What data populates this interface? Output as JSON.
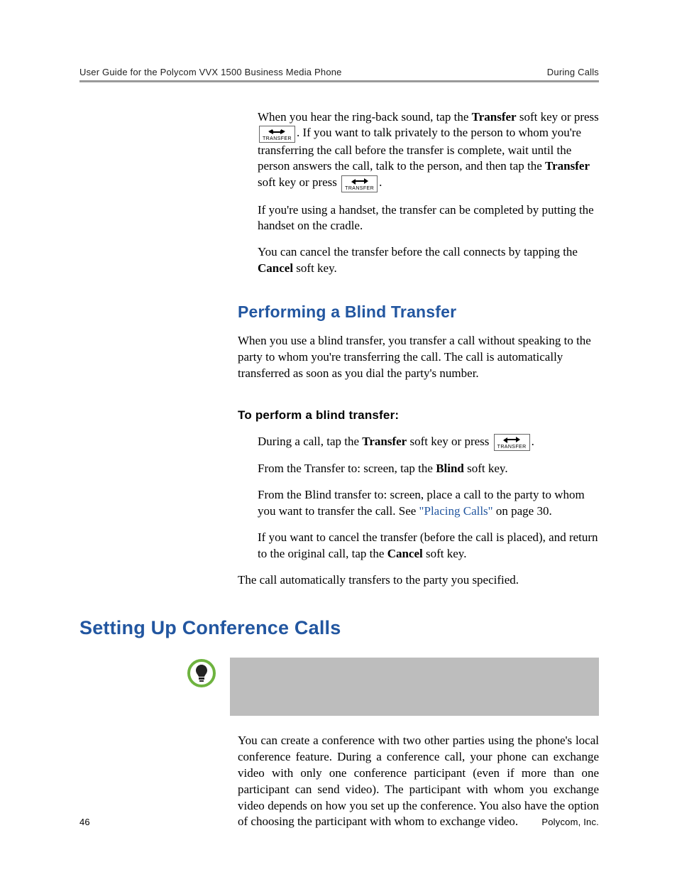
{
  "header": {
    "left": "User Guide for the Polycom VVX 1500 Business Media Phone",
    "right": "During Calls"
  },
  "body": {
    "p1a": "When you hear the ring-back sound, tap the ",
    "p1b": "Transfer",
    "p1c": " soft key or press ",
    "p1d": ". If you want to talk privately to the person to whom you're transferring the call before the transfer is complete, wait until the person answers the call, talk to the person, and then tap the ",
    "p1e": "Transfer",
    "p1f": " soft key or press ",
    "p1g": ".",
    "p2": "If you're using a handset, the transfer can be completed by putting the handset on the cradle.",
    "p3a": "You can cancel the transfer before the call connects by tapping the ",
    "p3b": "Cancel",
    "p3c": " soft key.",
    "h2_blind": "Performing a Blind Transfer",
    "p4": "When you use a blind transfer, you transfer a call without speaking to the party to whom you're transferring the call. The call is automatically transferred as soon as you dial the party's number.",
    "steps_heading": "To perform a blind transfer:",
    "s1a": "During a call, tap the ",
    "s1b": "Transfer",
    "s1c": " soft key or press ",
    "s1d": ".",
    "s2a": "From the Transfer to: screen, tap the ",
    "s2b": "Blind",
    "s2c": " soft key.",
    "s3a": "From the Blind transfer to: screen, place a call to the party to whom you want to transfer the call. See ",
    "s3link": "\"Placing Calls\"",
    "s3b": " on page 30.",
    "s4a": "If you want to cancel the transfer (before the call is placed), and return to the original call, tap the ",
    "s4b": "Cancel",
    "s4c": " soft key.",
    "p5": "The call automatically transfers to the party you specified.",
    "h1_conf": "Setting Up Conference Calls",
    "p6": "You can create a conference with two other parties using the phone's local conference feature. During a conference call, your phone can exchange video with only one conference participant (even if more than one participant can send video). The participant with whom you exchange video depends on how you set up the conference. You also have the option of choosing the participant with whom to exchange video."
  },
  "transfer_key_label": "TRANSFER",
  "footer": {
    "page": "46",
    "company": "Polycom, Inc."
  }
}
